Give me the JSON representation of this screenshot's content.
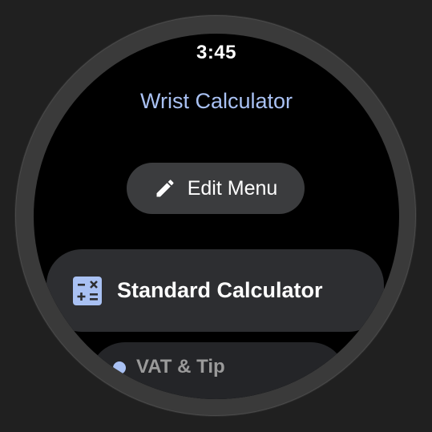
{
  "status": {
    "time": "3:45"
  },
  "app": {
    "title": "Wrist Calculator"
  },
  "edit_menu": {
    "label": "Edit Menu",
    "icon": "pencil-icon"
  },
  "menu_items": [
    {
      "label": "Standard Calculator",
      "icon": "calculator-icon",
      "icon_color": "#a9c1f3"
    },
    {
      "label": "VAT & Tip",
      "icon": "vat-tip-icon",
      "icon_color": "#a9c1f3"
    }
  ],
  "colors": {
    "accent": "#a9c1f3",
    "background": "#000000",
    "chip": "#2d2e31"
  }
}
